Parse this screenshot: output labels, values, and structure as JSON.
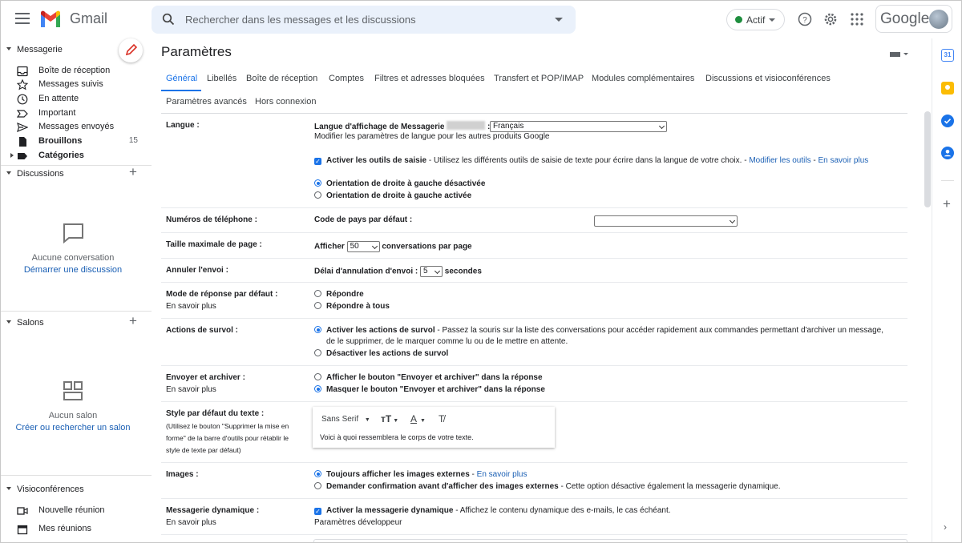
{
  "header": {
    "brand": "Gmail",
    "search_placeholder": "Rechercher dans les messages et les discussions",
    "status": "Actif",
    "google": "Google"
  },
  "sidebar": {
    "messagerie": "Messagerie",
    "items": [
      {
        "label": "Boîte de réception",
        "icon": "inbox-icon"
      },
      {
        "label": "Messages suivis",
        "icon": "star-icon"
      },
      {
        "label": "En attente",
        "icon": "clock-icon"
      },
      {
        "label": "Important",
        "icon": "important-icon"
      },
      {
        "label": "Messages envoyés",
        "icon": "send-icon"
      },
      {
        "label": "Brouillons",
        "icon": "draft-icon",
        "count": "15"
      },
      {
        "label": "Catégories",
        "icon": "label-icon"
      }
    ],
    "discussions": "Discussions",
    "no_conv": "Aucune conversation",
    "start_disc": "Démarrer une discussion",
    "salons": "Salons",
    "no_salon": "Aucun salon",
    "find_salon": "Créer ou rechercher un salon",
    "visio": "Visioconférences",
    "new_meeting": "Nouvelle réunion",
    "my_meetings": "Mes réunions"
  },
  "main": {
    "title": "Paramètres",
    "tabs": [
      "Général",
      "Libellés",
      "Boîte de réception",
      "Comptes",
      "Filtres et adresses bloquées",
      "Transfert et POP/IMAP",
      "Modules complémentaires",
      "Discussions et visioconférences",
      "Paramètres avancés",
      "Hors connexion"
    ],
    "langue": {
      "label": "Langue :",
      "display": "Langue d'affichage de Messagerie",
      "colon": ":",
      "value": "Français",
      "link": "Modifier les paramètres de langue pour les autres produits Google",
      "tools_bold": "Activer les outils de saisie",
      "tools_text": " - Utilisez les différents outils de saisie de texte pour écrire dans la langue de votre choix. - ",
      "tools_link1": "Modifier les outils",
      "tools_sep": " - ",
      "tools_link2": "En savoir plus",
      "rtl_off": "Orientation de droite à gauche désactivée",
      "rtl_on": "Orientation de droite à gauche activée"
    },
    "phone": {
      "label": "Numéros de téléphone :",
      "text": "Code de pays par défaut :",
      "value": ""
    },
    "pagesize": {
      "label": "Taille maximale de page :",
      "pre": "Afficher",
      "value": "50",
      "post": "conversations par page"
    },
    "undo": {
      "label": "Annuler l'envoi :",
      "pre": "Délai d'annulation d'envoi :",
      "value": "5",
      "post": "secondes"
    },
    "reply": {
      "label": "Mode de réponse par défaut :",
      "link": "En savoir plus",
      "opt1": "Répondre",
      "opt2": "Répondre à tous"
    },
    "hover": {
      "label": "Actions de survol :",
      "opt1_bold": "Activer les actions de survol",
      "opt1_text": " - Passez la souris sur la liste des conversations pour accéder rapidement aux commandes permettant d'archiver un message,",
      "opt1_text2": "de le supprimer, de le marquer comme lu ou de le mettre en attente.",
      "opt2": "Désactiver les actions de survol"
    },
    "sendarchive": {
      "label": "Envoyer et archiver :",
      "link": "En savoir plus",
      "opt1": "Afficher le bouton \"Envoyer et archiver\" dans la réponse",
      "opt2": "Masquer le bouton \"Envoyer et archiver\" dans la réponse"
    },
    "textstyle": {
      "label": "Style par défaut du texte :",
      "hint": "(Utilisez le bouton \"Supprimer la mise en forme\" de la barre d'outils pour rétablir le style de texte par défaut)",
      "font": "Sans Serif",
      "preview": "Voici à quoi ressemblera le corps de votre texte."
    },
    "images": {
      "label": "Images :",
      "opt1_bold": "Toujours afficher les images externes",
      "opt1_sep": " - ",
      "opt1_link": "En savoir plus",
      "opt2_bold": "Demander confirmation avant d'afficher des images externes",
      "opt2_text": " - Cette option désactive également la messagerie dynamique."
    },
    "dynamic": {
      "label": "Messagerie dynamique :",
      "link": "En savoir plus",
      "bold": "Activer la messagerie dynamique",
      "text": " - Affichez le contenu dynamique des e-mails, le cas échéant.",
      "link2": "Paramètres développeur"
    }
  },
  "colors": {
    "accent": "#1a73e8",
    "link": "#1a5fb4",
    "status": "#1e8e3e"
  }
}
